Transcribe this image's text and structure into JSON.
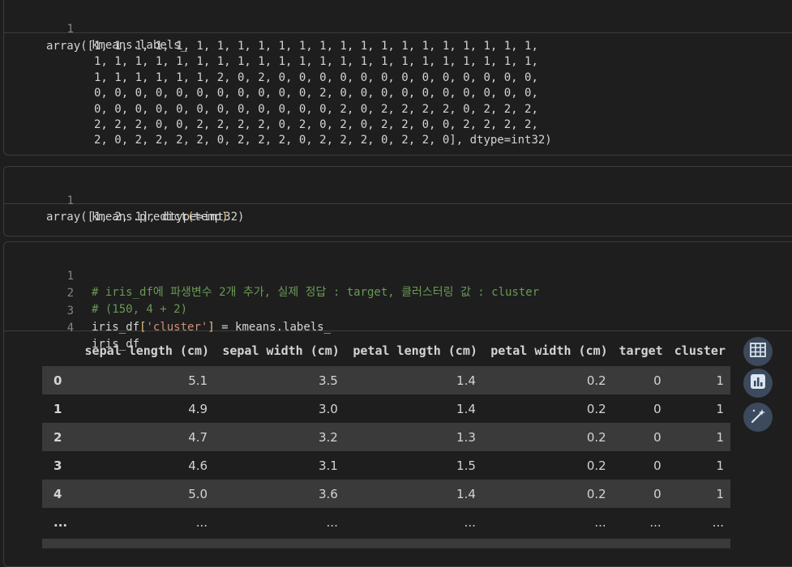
{
  "cell1": {
    "line_no": "1",
    "code": "kmeans.labels_",
    "output": "array([1, 1, 1, 1, 1, 1, 1, 1, 1, 1, 1, 1, 1, 1, 1, 1, 1, 1, 1, 1, 1, 1,\n       1, 1, 1, 1, 1, 1, 1, 1, 1, 1, 1, 1, 1, 1, 1, 1, 1, 1, 1, 1, 1, 1,\n       1, 1, 1, 1, 1, 1, 2, 0, 2, 0, 0, 0, 0, 0, 0, 0, 0, 0, 0, 0, 0, 0,\n       0, 0, 0, 0, 0, 0, 0, 0, 0, 0, 0, 2, 0, 0, 0, 0, 0, 0, 0, 0, 0, 0,\n       0, 0, 0, 0, 0, 0, 0, 0, 0, 0, 0, 0, 2, 0, 2, 2, 2, 2, 0, 2, 2, 2,\n       2, 2, 2, 0, 0, 2, 2, 2, 2, 0, 2, 0, 2, 0, 2, 2, 0, 0, 2, 2, 2, 2,\n       2, 0, 2, 2, 2, 2, 0, 2, 2, 2, 0, 2, 2, 2, 0, 2, 2, 0], dtype=int32)"
  },
  "cell2": {
    "line_no": "1",
    "code_prefix": "kmeans.predict",
    "paren_open": "(",
    "code_arg": "temp",
    "paren_close": ")",
    "output": "array([1, 2, 1], dtype=int32)"
  },
  "cell3": {
    "lines": [
      {
        "no": "1",
        "comment": "# iris_df에 파생변수 2개 추가, 실제 정답 : target, 클러스터링 값 : cluster"
      },
      {
        "no": "2",
        "comment": "# (150, 4 + 2)"
      },
      {
        "no": "3",
        "pre": "iris_df",
        "bracket_open": "[",
        "str": "'cluster'",
        "bracket_close": "]",
        "post": " = kmeans.labels_"
      },
      {
        "no": "4",
        "code": "iris_df"
      }
    ]
  },
  "dataframe": {
    "columns": [
      "sepal length (cm)",
      "sepal width (cm)",
      "petal length (cm)",
      "petal width (cm)",
      "target",
      "cluster"
    ],
    "rows": [
      {
        "idx": "0",
        "vals": [
          "5.1",
          "3.5",
          "1.4",
          "0.2",
          "0",
          "1"
        ]
      },
      {
        "idx": "1",
        "vals": [
          "4.9",
          "3.0",
          "1.4",
          "0.2",
          "0",
          "1"
        ]
      },
      {
        "idx": "2",
        "vals": [
          "4.7",
          "3.2",
          "1.3",
          "0.2",
          "0",
          "1"
        ]
      },
      {
        "idx": "3",
        "vals": [
          "4.6",
          "3.1",
          "1.5",
          "0.2",
          "0",
          "1"
        ]
      },
      {
        "idx": "4",
        "vals": [
          "5.0",
          "3.6",
          "1.4",
          "0.2",
          "0",
          "1"
        ]
      },
      {
        "idx": "...",
        "vals": [
          "...",
          "...",
          "...",
          "...",
          "...",
          "..."
        ]
      }
    ]
  },
  "side_buttons": [
    {
      "icon": "table-icon"
    },
    {
      "icon": "chart-icon"
    },
    {
      "icon": "magic-wand-icon"
    }
  ]
}
